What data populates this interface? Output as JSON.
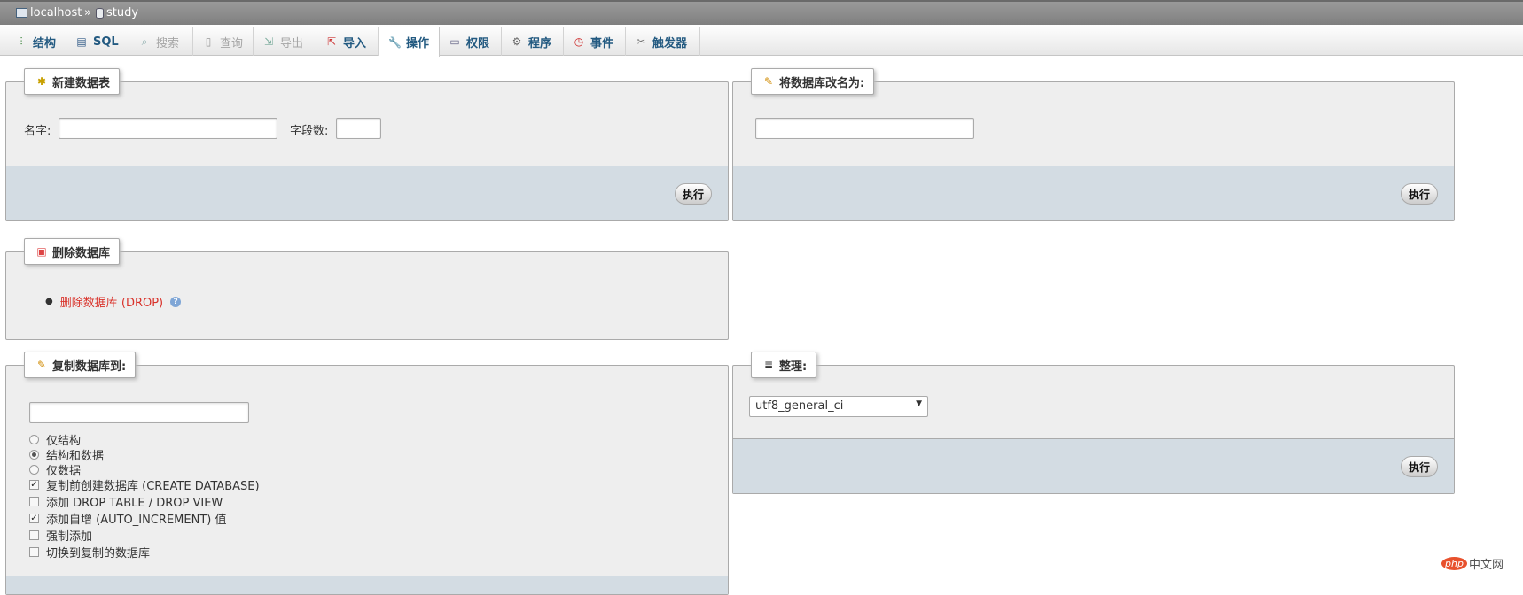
{
  "breadcrumb": {
    "server": "localhost",
    "separator": "»",
    "database": "study"
  },
  "tabs": [
    {
      "label": "结构",
      "icon": "structure-icon",
      "glyph": "⫶",
      "state": "normal"
    },
    {
      "label": "SQL",
      "icon": "sql-icon",
      "glyph": "▤",
      "state": "normal"
    },
    {
      "label": "搜索",
      "icon": "search-icon",
      "glyph": "🔍",
      "state": "disabled"
    },
    {
      "label": "查询",
      "icon": "query-icon",
      "glyph": "▯",
      "state": "disabled"
    },
    {
      "label": "导出",
      "icon": "export-icon",
      "glyph": "⇲",
      "state": "disabled"
    },
    {
      "label": "导入",
      "icon": "import-icon",
      "glyph": "⇱",
      "state": "normal"
    },
    {
      "label": "操作",
      "icon": "wrench-icon",
      "glyph": "🔧",
      "state": "active"
    },
    {
      "label": "权限",
      "icon": "privileges-icon",
      "glyph": "▭",
      "state": "normal"
    },
    {
      "label": "程序",
      "icon": "routines-icon",
      "glyph": "⚙",
      "state": "normal"
    },
    {
      "label": "事件",
      "icon": "events-icon",
      "glyph": "◷",
      "state": "normal"
    },
    {
      "label": "触发器",
      "icon": "triggers-icon",
      "glyph": "✂",
      "state": "normal"
    }
  ],
  "create_table": {
    "legend": "新建数据表",
    "name_label": "名字:",
    "name_value": "",
    "fields_label": "字段数:",
    "fields_value": "",
    "submit": "执行"
  },
  "rename_db": {
    "legend": "将数据库改名为:",
    "new_name_value": "",
    "submit": "执行"
  },
  "drop_db": {
    "legend": "删除数据库",
    "link": "删除数据库 (DROP)"
  },
  "copy_db": {
    "legend": "复制数据库到:",
    "target_value": "",
    "options": [
      {
        "label": "仅结构",
        "type": "radio",
        "checked": false
      },
      {
        "label": "结构和数据",
        "type": "radio",
        "checked": true
      },
      {
        "label": "仅数据",
        "type": "radio",
        "checked": false
      },
      {
        "label": "复制前创建数据库 (CREATE DATABASE)",
        "type": "checkbox",
        "checked": true
      },
      {
        "label": "添加 DROP TABLE / DROP VIEW",
        "type": "checkbox",
        "checked": false
      },
      {
        "label": "添加自增 (AUTO_INCREMENT) 值",
        "type": "checkbox",
        "checked": true
      },
      {
        "label": "强制添加",
        "type": "checkbox",
        "checked": false
      },
      {
        "label": "切换到复制的数据库",
        "type": "checkbox",
        "checked": false
      }
    ]
  },
  "collation": {
    "legend": "整理:",
    "selected": "utf8_general_ci",
    "submit": "执行"
  },
  "watermark": {
    "badge": "php",
    "text": "中文网"
  }
}
